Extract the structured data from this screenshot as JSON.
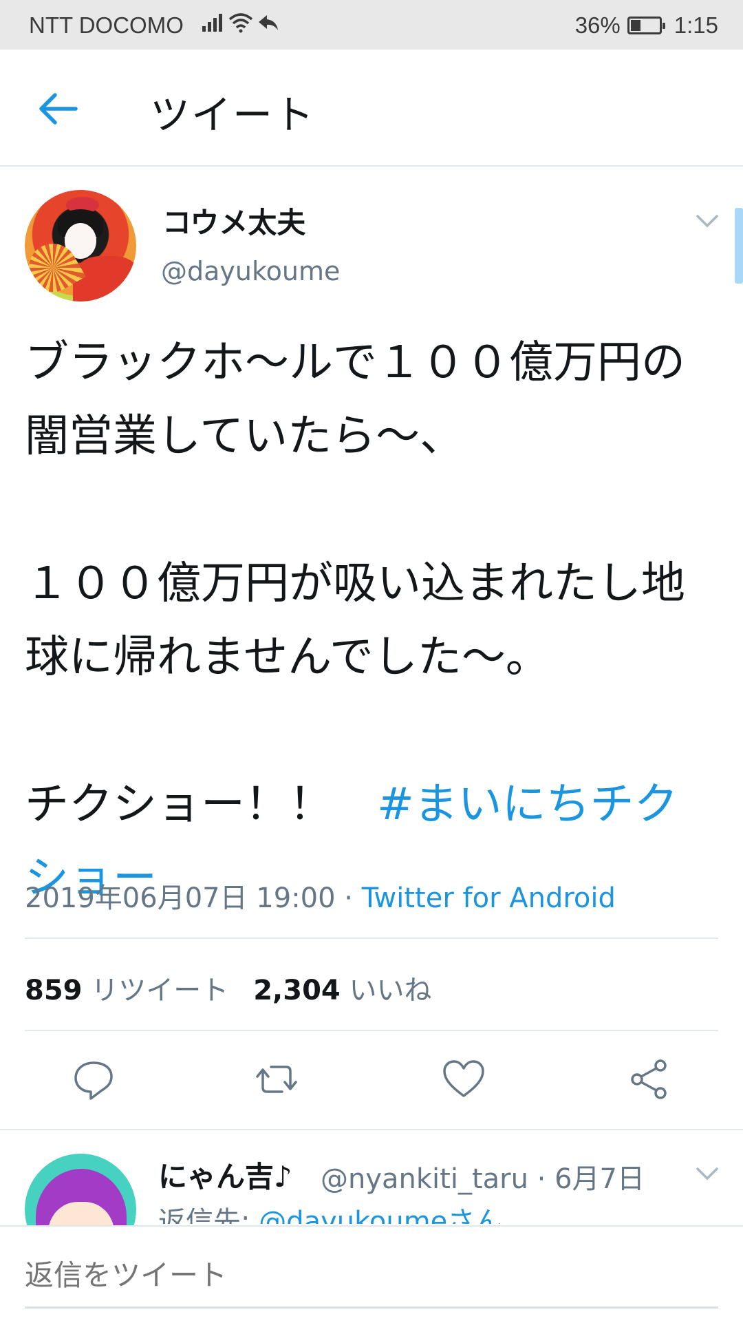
{
  "status_bar": {
    "carrier": "NTT DOCOMO",
    "battery_percent": "36%",
    "battery_level": 0.36,
    "time": "1:15",
    "icons": [
      "signal-icon",
      "wifi-icon",
      "call-forward-icon",
      "battery-icon"
    ]
  },
  "app_bar": {
    "title": "ツイート",
    "back_icon": "back-arrow-icon"
  },
  "tweet": {
    "display_name": "コウメ太夫",
    "handle": "@dayukoume",
    "text_lines": [
      "ブラックホ〜ルで１００億万円の",
      "闇営業していたら〜、",
      "１００億万円が吸い込まれたし地",
      "球に帰れませんでした〜。",
      "チクショー！！　"
    ],
    "hashtag_part1": "#まいにちチク",
    "hashtag_part2": "ショー",
    "timestamp": "2019年06月07日 19:00 · ",
    "source": "Twitter for Android",
    "retweet_count": "859",
    "retweet_label": "リツイート",
    "like_count": "2,304",
    "like_label": "いいね",
    "actions": [
      "reply-icon",
      "retweet-icon",
      "like-icon",
      "share-icon"
    ]
  },
  "reply": {
    "display_name": "にゃん吉♪",
    "handle": "@nyankiti_taru · 6月7日",
    "reply_prefix": "返信先: ",
    "reply_mention": "@dayukoumeさん"
  },
  "composer": {
    "placeholder": "返信をツイート"
  },
  "colors": {
    "accent": "#1b95e0",
    "secondary_text": "#657786",
    "primary_text": "#14171a",
    "divider": "#e1e8ed"
  }
}
